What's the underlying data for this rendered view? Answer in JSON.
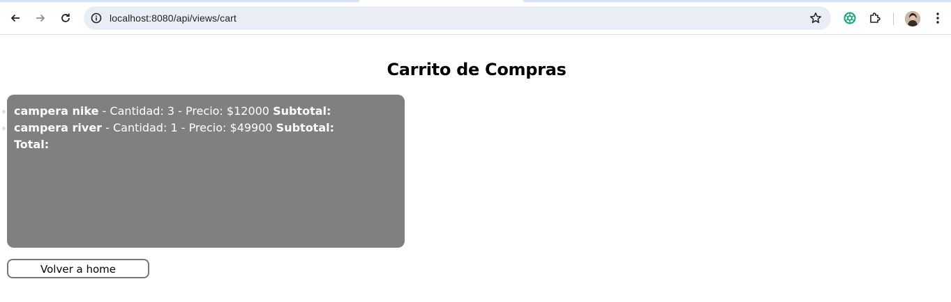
{
  "browser": {
    "url": "localhost:8080/api/views/cart",
    "icons": {
      "back": "arrow-left-icon",
      "forward": "arrow-right-icon",
      "reload": "reload-icon",
      "site_info": "info-icon",
      "bookmark": "star-icon",
      "extension_chatgpt": "chatgpt-icon",
      "extensions": "puzzle-icon",
      "profile": "avatar",
      "menu": "kebab-menu-icon"
    },
    "colors": {
      "omnibox_bg": "#e9eef6",
      "chatgpt": "#10a37f"
    }
  },
  "page": {
    "title": "Carrito de Compras",
    "items": [
      {
        "name": "campera nike",
        "detail": " - Cantidad: 3 - Precio: $12000 ",
        "subtotal_label": "Subtotal:"
      },
      {
        "name": "campera river",
        "detail": " - Cantidad: 1 - Precio: $49900 ",
        "subtotal_label": "Subtotal:"
      }
    ],
    "total_label": "Total:",
    "home_button": "Volver a home",
    "colors": {
      "cart_bg": "#808080",
      "text": "#ffffff"
    }
  }
}
